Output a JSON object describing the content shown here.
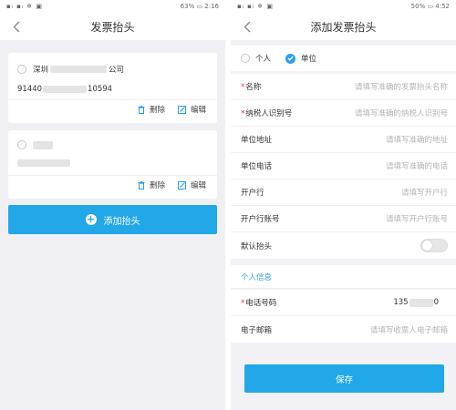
{
  "left": {
    "status": {
      "left_icons": "▪ₗ ▪ₗ ❄ ▣",
      "right": "63% ▭ 2:16"
    },
    "title": "发票抬头",
    "cards": [
      {
        "name_prefix": "深圳",
        "name_suffix": "公司",
        "code_prefix": "91440",
        "code_suffix": "10594",
        "delete_label": "删除",
        "edit_label": "编辑"
      },
      {
        "delete_label": "删除",
        "edit_label": "编辑"
      }
    ],
    "add_button": "添加抬头"
  },
  "right": {
    "status": {
      "left_icons": "▪ₗ ▪ₗ ❄ ▣",
      "right": "50% ▭ 4:52"
    },
    "title": "添加发票抬头",
    "type_options": [
      {
        "label": "个人",
        "selected": false
      },
      {
        "label": "单位",
        "selected": true
      }
    ],
    "fields": [
      {
        "label": "名称",
        "required": true,
        "placeholder": "请填写准确的发票抬头名称"
      },
      {
        "label": "纳税人识别号",
        "required": true,
        "placeholder": "请填写准确的纳税人识别号"
      },
      {
        "label": "单位地址",
        "required": false,
        "placeholder": "请填写准确的地址"
      },
      {
        "label": "单位电话",
        "required": false,
        "placeholder": "请填写准确的电话"
      },
      {
        "label": "开户行",
        "required": false,
        "placeholder": "请填写开户行"
      },
      {
        "label": "开户行账号",
        "required": false,
        "placeholder": "请填写开户行账号"
      }
    ],
    "default_label": "默认抬头",
    "default_on": false,
    "section_personal": "个人信息",
    "phone": {
      "label": "电话号码",
      "required": true,
      "value_prefix": "135",
      "value_suffix": "0"
    },
    "email": {
      "label": "电子邮箱",
      "required": false,
      "placeholder": "请填写收票人电子邮箱"
    },
    "save_button": "保存"
  },
  "colors": {
    "accent": "#22a7e8",
    "link": "#2b9ff2",
    "required": "#e33333",
    "page_bg": "#efeff4"
  }
}
